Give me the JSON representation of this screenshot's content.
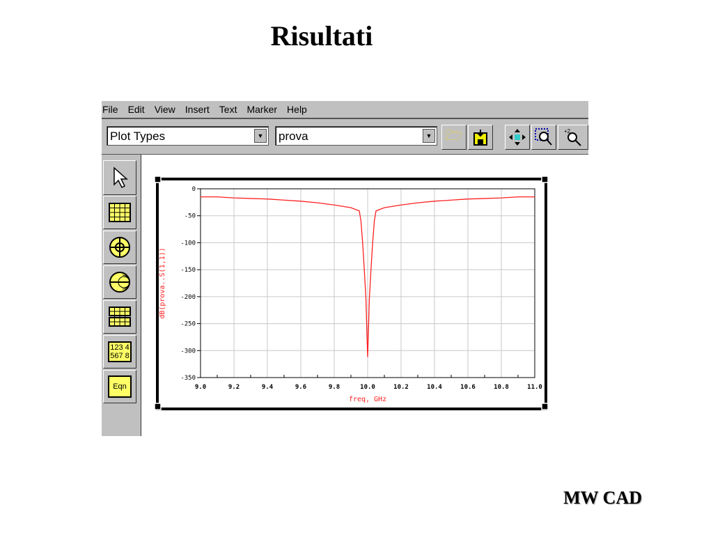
{
  "slide": {
    "title": "Risultati",
    "footer": "MW CAD"
  },
  "menu": [
    "File",
    "Edit",
    "View",
    "Insert",
    "Text",
    "Marker",
    "Help"
  ],
  "toolbar": {
    "plot_types": "Plot Types",
    "dataset": "prova",
    "buttons": [
      "open-folder",
      "save",
      "move",
      "zoom-area",
      "zoom-2x"
    ]
  },
  "palette": {
    "items": [
      "pointer",
      "rectangular-plot",
      "polar-plot",
      "smith-chart",
      "list",
      "stack",
      "equation"
    ],
    "stack_label": "123 4\n567 8",
    "eqn_label": "Eqn"
  },
  "chart_data": {
    "type": "line",
    "xlabel": "freq, GHz",
    "ylabel": "dB(prova..S(1,1))",
    "xlim": [
      9.0,
      11.0
    ],
    "ylim": [
      -350,
      0
    ],
    "xticks": [
      "9.0",
      "9.2",
      "9.4",
      "9.6",
      "9.8",
      "10.0",
      "10.2",
      "10.4",
      "10.6",
      "10.8",
      "11.0"
    ],
    "yticks": [
      "0",
      "-50",
      "-100",
      "-150",
      "-200",
      "-250",
      "-300",
      "-350"
    ],
    "grid": true,
    "color": "#ff2020",
    "series": [
      {
        "name": "dB(prova..S(1,1))",
        "x": [
          9.0,
          9.1,
          9.2,
          9.3,
          9.4,
          9.5,
          9.6,
          9.7,
          9.8,
          9.9,
          9.95,
          9.96,
          9.97,
          9.98,
          9.99,
          9.995,
          10.0,
          10.005,
          10.01,
          10.02,
          10.03,
          10.04,
          10.05,
          10.1,
          10.2,
          10.3,
          10.4,
          10.5,
          10.6,
          10.7,
          10.8,
          10.9,
          11.0
        ],
        "y": [
          -15,
          -15,
          -17,
          -18,
          -19,
          -21,
          -23,
          -26,
          -30,
          -35,
          -41,
          -60,
          -100,
          -150,
          -205,
          -262,
          -312,
          -262,
          -205,
          -150,
          -100,
          -60,
          -41,
          -35,
          -30,
          -26,
          -23,
          -21,
          -19,
          -18,
          -17,
          -15,
          -15
        ]
      }
    ]
  }
}
